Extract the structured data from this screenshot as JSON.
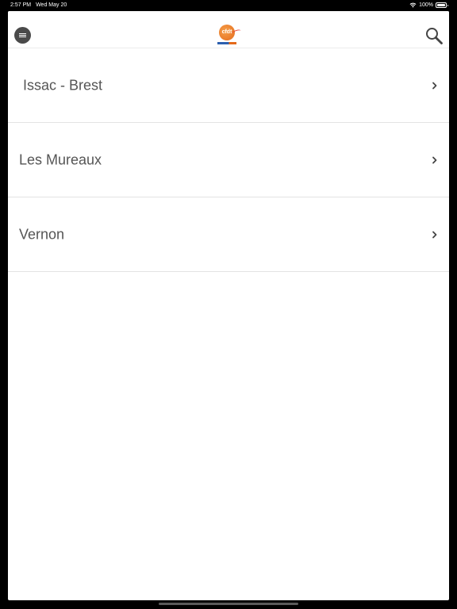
{
  "status_bar": {
    "time": "2:57 PM",
    "date": "Wed May 20",
    "battery_percent": "100%",
    "battery_level": 1.0
  },
  "nav_bar": {
    "menu_icon": "hamburger-menu-icon",
    "logo_text": "cfdt",
    "search_icon": "magnifier-icon"
  },
  "locations": [
    {
      "label": "Issac - Brest",
      "icon": "chevron-right-icon"
    },
    {
      "label": "Les Mureaux",
      "icon": "chevron-right-icon"
    },
    {
      "label": "Vernon",
      "icon": "chevron-right-icon"
    }
  ],
  "colors": {
    "accent": "#e46a1b",
    "text": "#555555",
    "menu_button": "#4a4a4a"
  }
}
